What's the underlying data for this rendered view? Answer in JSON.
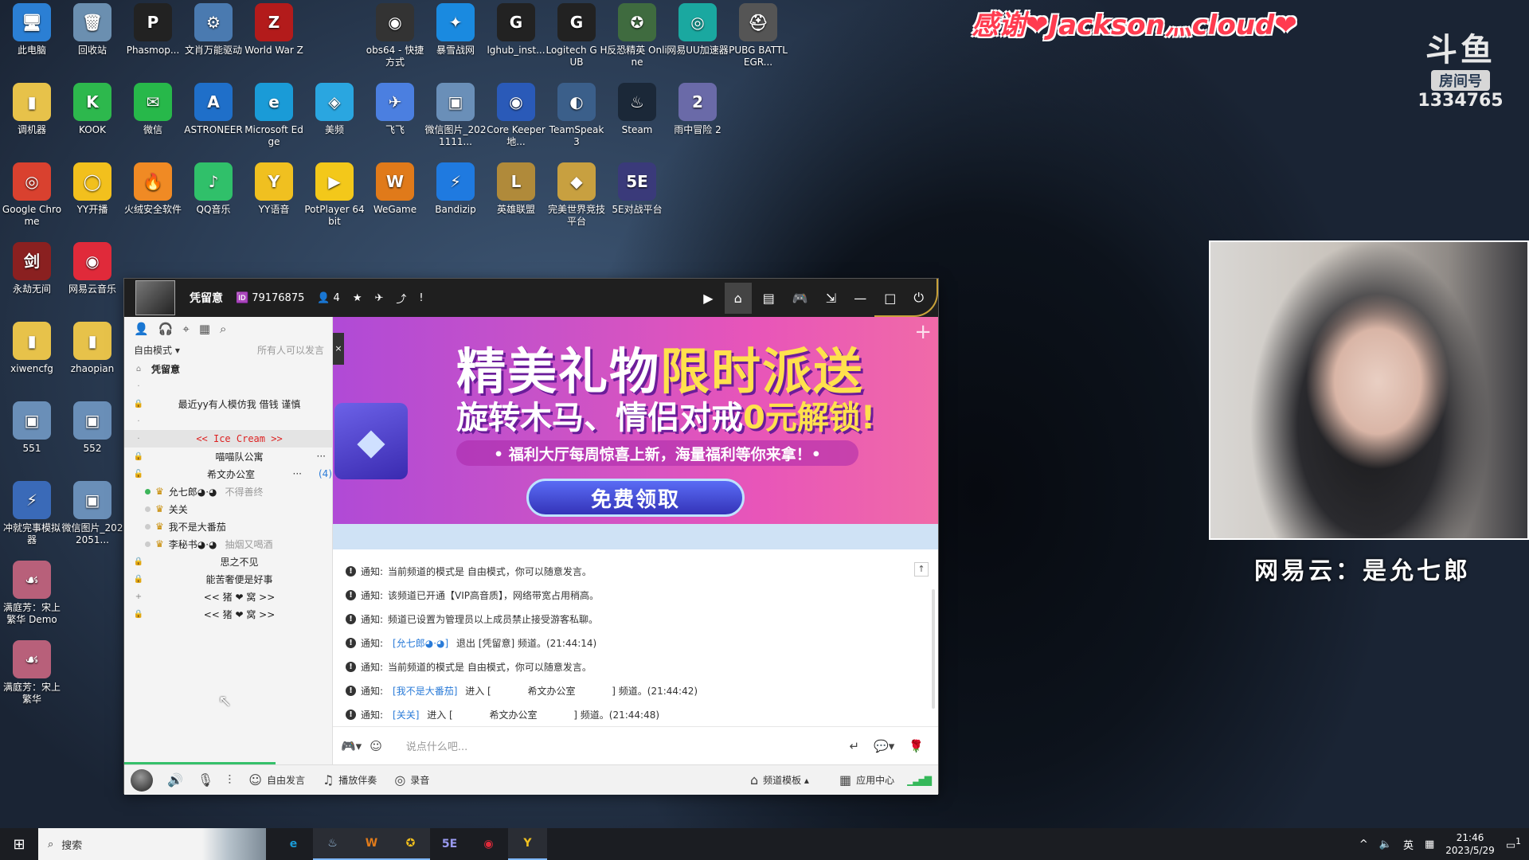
{
  "desktop": {
    "icons": [
      {
        "label": "此电脑",
        "glyph": "🖥",
        "color": "#2b7fd4"
      },
      {
        "label": "回收站",
        "glyph": "🗑",
        "color": "#6b8fb0"
      },
      {
        "label": "Phasmop...",
        "glyph": "P",
        "color": "#222222"
      },
      {
        "label": "文肖万能驱动",
        "glyph": "⚙",
        "color": "#4a7ab0"
      },
      {
        "label": "World War Z",
        "glyph": "Z",
        "color": "#b31b1b"
      },
      {
        "label": "obs64 - 快捷方式",
        "glyph": "◉",
        "color": "#333333"
      },
      {
        "label": "暴雪战网",
        "glyph": "✦",
        "color": "#1a8ae0"
      },
      {
        "label": "lghub_inst...",
        "glyph": "G",
        "color": "#222222"
      },
      {
        "label": "Logitech G HUB",
        "glyph": "G",
        "color": "#222222"
      },
      {
        "label": "反恐精英 Online",
        "glyph": "✪",
        "color": "#3f6b3f"
      },
      {
        "label": "网易UU加速器",
        "glyph": "◎",
        "color": "#1aa8a0"
      },
      {
        "label": "PUBG BATTLEGR...",
        "glyph": "⛑",
        "color": "#555555"
      },
      {
        "label": "调机器",
        "glyph": "▮",
        "color": "#e7c24a"
      },
      {
        "label": "KOOK",
        "glyph": "K",
        "color": "#2db84d"
      },
      {
        "label": "微信",
        "glyph": "✉",
        "color": "#27b84a"
      },
      {
        "label": "ASTRONEER",
        "glyph": "A",
        "color": "#1f6fc9"
      },
      {
        "label": "Microsoft Edge",
        "glyph": "e",
        "color": "#1a9bd7"
      },
      {
        "label": "美频",
        "glyph": "◈",
        "color": "#2aa6e0"
      },
      {
        "label": "飞飞",
        "glyph": "✈",
        "color": "#4b7fe0"
      },
      {
        "label": "微信图片_2021111...",
        "glyph": "▣",
        "color": "#6a8fb8"
      },
      {
        "label": "Core Keeper 地...",
        "glyph": "◉",
        "color": "#2a5ab8"
      },
      {
        "label": "TeamSpeak 3",
        "glyph": "◐",
        "color": "#3b5f8a"
      },
      {
        "label": "Steam",
        "glyph": "♨",
        "color": "#1b2838"
      },
      {
        "label": "雨中冒险 2",
        "glyph": "2",
        "color": "#6a6aa8"
      },
      {
        "label": "Google Chrome",
        "glyph": "◎",
        "color": "#d9412f"
      },
      {
        "label": "YY开播",
        "glyph": "◯",
        "color": "#f2c01d"
      },
      {
        "label": "火绒安全软件",
        "glyph": "🔥",
        "color": "#f08a24"
      },
      {
        "label": "QQ音乐",
        "glyph": "♪",
        "color": "#30c06a"
      },
      {
        "label": "YY语音",
        "glyph": "Y",
        "color": "#f0c020"
      },
      {
        "label": "PotPlayer 64 bit",
        "glyph": "▶",
        "color": "#f3c81a"
      },
      {
        "label": "WeGame",
        "glyph": "W",
        "color": "#e07a1a"
      },
      {
        "label": "Bandizip",
        "glyph": "⚡",
        "color": "#1f7ae0"
      },
      {
        "label": "英雄联盟",
        "glyph": "L",
        "color": "#b08a3a"
      },
      {
        "label": "完美世界竞技平台",
        "glyph": "◆",
        "color": "#c8a040"
      },
      {
        "label": "5E对战平台",
        "glyph": "5E",
        "color": "#3a3a7a"
      },
      {
        "label": "永劫无间",
        "glyph": "剑",
        "color": "#8a2020"
      },
      {
        "label": "网易云音乐",
        "glyph": "◉",
        "color": "#e02a3a"
      },
      {
        "label": "xiwencfg",
        "glyph": "▮",
        "color": "#e7c24a"
      },
      {
        "label": "zhaopian",
        "glyph": "▮",
        "color": "#e7c24a"
      },
      {
        "label": "551",
        "glyph": "▣",
        "color": "#6a8fb8"
      },
      {
        "label": "552",
        "glyph": "▣",
        "color": "#6a8fb8"
      },
      {
        "label": "冲就完事模拟器",
        "glyph": "⚡",
        "color": "#3a6ab8"
      },
      {
        "label": "微信图片_2022051...",
        "glyph": "▣",
        "color": "#6a8fb8"
      },
      {
        "label": "满庭芳：宋上繁华 Demo",
        "glyph": "☙",
        "color": "#b8607a"
      },
      {
        "label": "满庭芳：宋上繁华",
        "glyph": "☙",
        "color": "#b8607a"
      }
    ]
  },
  "overlay": {
    "thanks": "感谢❤Jackson灬cloud❤",
    "douyu_mark": "斗鱼",
    "room_tag": "房间号",
    "room_number": "1334765",
    "caption": "网易云：是允七郎"
  },
  "yy": {
    "channel_name": "凭留意",
    "channel_id": "79176875",
    "online_count": "4",
    "toolbar_icons": [
      "user-icon",
      "headset-icon",
      "location-icon",
      "notes-icon",
      "search-icon"
    ],
    "mode_label": "自由模式 ▾",
    "mode_hint": "所有人可以发言",
    "tree": {
      "root": "凭留意",
      "rows": [
        {
          "name": "",
          "lock": "·"
        },
        {
          "name": "最近yy有人模仿我 借钱 谨慎",
          "lock": "🔒"
        },
        {
          "name": "",
          "lock": "·"
        },
        {
          "name": "<<  Ice Cream  >>",
          "lock": "·"
        },
        {
          "name": "喵喵队公寓",
          "lock": "🔒"
        },
        {
          "name": "希文办公室",
          "lock": "🔓",
          "count": "(4)"
        }
      ],
      "users": [
        {
          "name": "允七郎◕·◕",
          "sig": "不得善终",
          "online": true
        },
        {
          "name": "关关",
          "sig": "",
          "online": false
        },
        {
          "name": "我不是大番茄",
          "sig": "",
          "online": false
        },
        {
          "name": "李秘书◕·◕",
          "sig": "抽烟又喝酒",
          "online": false
        }
      ],
      "rows_after": [
        {
          "name": "思之不见",
          "lock": "🔒"
        },
        {
          "name": "能苦奢便是好事",
          "lock": "🔒"
        },
        {
          "name": "<<  猪 ❤ 窝  >>",
          "lock": "+"
        },
        {
          "name": "<<  猪 ❤ 窝  >>",
          "lock": "🔒"
        }
      ]
    },
    "banner": {
      "title_a": "精美礼物",
      "title_b": "限时派送",
      "subtitle_a": "旋转木马、情侣对戒",
      "subtitle_b": "0元解锁!",
      "subline": "• 福利大厅每周惊喜上新，海量福利等你来拿！•",
      "cta": "免费领取"
    },
    "chat": [
      {
        "prefix": "通知:",
        "text": "当前频道的模式是 自由模式，你可以随意发言。",
        "link": "",
        "tail": ""
      },
      {
        "prefix": "通知:",
        "text": "该频道已开通【VIP高音质】，网络带宽占用稍高。",
        "link": "",
        "tail": ""
      },
      {
        "prefix": "通知:",
        "text": "频道已设置为管理员以上成员禁止接受游客私聊。",
        "link": "",
        "tail": ""
      },
      {
        "prefix": "通知:",
        "text": "",
        "link": "[允七郎◕·◕]",
        "tail": " 退出 [凭留意] 频道。(21:44:14)"
      },
      {
        "prefix": "通知:",
        "text": "当前频道的模式是 自由模式，你可以随意发言。",
        "link": "",
        "tail": ""
      },
      {
        "prefix": "通知:",
        "text": "",
        "link": "[我不是大番茄]",
        "tail": " 进入 [            希文办公室            ] 频道。(21:44:42)"
      },
      {
        "prefix": "通知:",
        "text": "",
        "link": "[关关]",
        "tail": " 进入 [            希文办公室            ] 频道。(21:44:48)"
      }
    ],
    "input_placeholder": "说点什么吧...",
    "bottom": {
      "free_speak": "自由发言",
      "play_music": "播放伴奏",
      "record": "录音",
      "channel_template": "频道模板 ▴",
      "app_center": "应用中心"
    }
  },
  "taskbar": {
    "search_placeholder": "搜索",
    "apps": [
      {
        "glyph": "e",
        "color": "#1a9bd7",
        "active": false
      },
      {
        "glyph": "♨",
        "color": "#9fc5e8",
        "active": true
      },
      {
        "glyph": "W",
        "color": "#e07a1a",
        "active": true
      },
      {
        "glyph": "✪",
        "color": "#f2c01d",
        "active": true
      },
      {
        "glyph": "5E",
        "color": "#9a9af0",
        "active": false
      },
      {
        "glyph": "◉",
        "color": "#e02a3a",
        "active": false
      },
      {
        "glyph": "Y",
        "color": "#f0c020",
        "active": true
      }
    ],
    "tray_lang": "英",
    "time": "21:46",
    "date": "2023/5/29",
    "notif_count": "1"
  }
}
